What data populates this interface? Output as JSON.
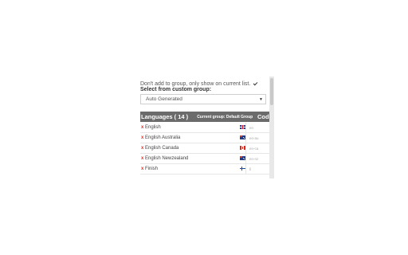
{
  "options": {
    "dont_add_label": "Don't add to group, only show on current list.",
    "dont_add_checked": true
  },
  "custom_group": {
    "label": "Select from custom group:",
    "selected": "Auto Generated"
  },
  "table": {
    "header_languages": "Languages ( 14 )",
    "header_group": "Current group: Default Group",
    "header_code": "Code",
    "rows": [
      {
        "remove": "x",
        "name": "English",
        "flag": "gb",
        "code": "en"
      },
      {
        "remove": "x",
        "name": "English Australia",
        "flag": "au",
        "code": "en-au"
      },
      {
        "remove": "x",
        "name": "English Canada",
        "flag": "ca",
        "code": "en-ca"
      },
      {
        "remove": "x",
        "name": "English Newzealand",
        "flag": "nz",
        "code": "en-nz"
      },
      {
        "remove": "x",
        "name": "Finish",
        "flag": "fi",
        "code": "fi"
      }
    ]
  }
}
